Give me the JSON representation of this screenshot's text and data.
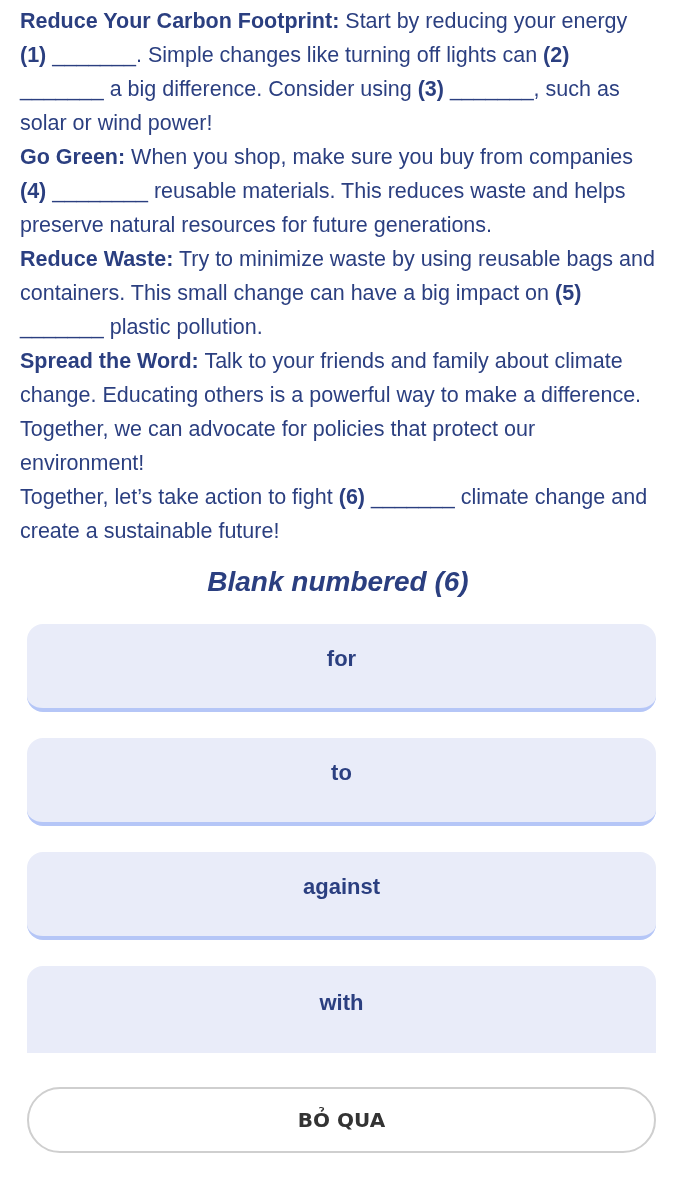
{
  "passage": [
    "**Reduce Your Carbon Footprint:** Start by reducing your energy **(1)** _______. Simple changes like turning off lights can **(2)** _______ a big difference. Consider using **(3)** _______, such as solar or wind power!",
    "**Go Green:** When you shop, make sure you buy from companies **(4)** ________ reusable materials. This reduces waste and helps preserve natural resources for future generations.",
    "**Reduce Waste:** Try to minimize waste by using reusable bags and containers. This small change can have a big impact on **(5)** _______ plastic pollution.",
    "**Spread the Word:** Talk to your friends and family about climate change. Educating others is a powerful way to make a difference. Together, we can advocate for policies that protect our environment!",
    "Together, let’s take action to fight **(6)** _______ climate change and create a sustainable future!"
  ],
  "question": "Blank numbered (6)",
  "options": [
    {
      "label": "for"
    },
    {
      "label": "to"
    },
    {
      "label": "against"
    },
    {
      "label": "with"
    }
  ],
  "skip_button": "BỎ QUA"
}
